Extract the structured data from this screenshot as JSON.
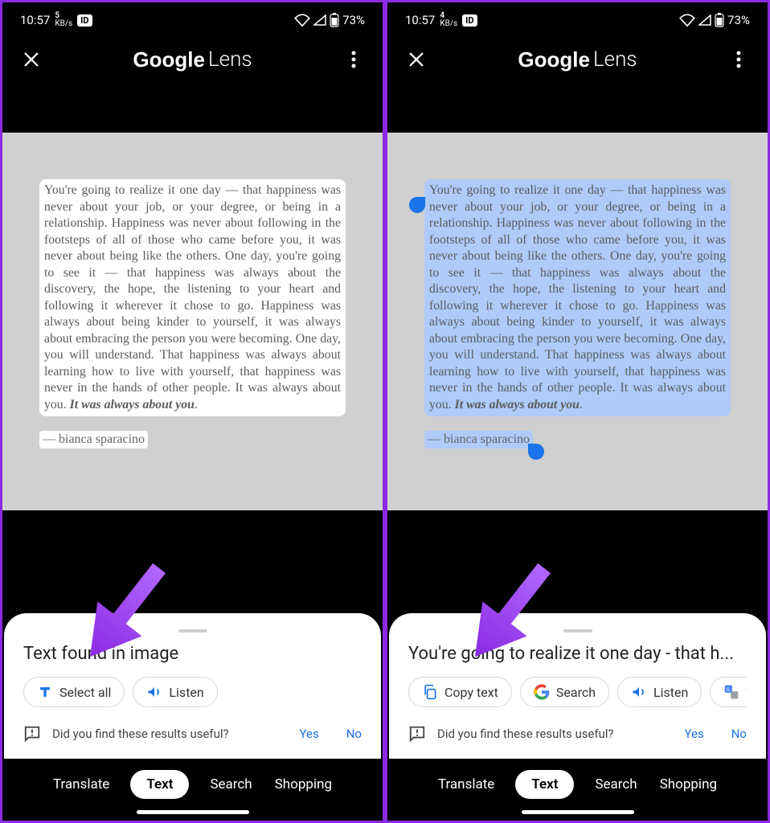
{
  "status": {
    "time": "10:57",
    "kbs1": "5",
    "kbs2": "4",
    "kbs_unit": "KB/s",
    "battery": "73%"
  },
  "app": {
    "title_google": "Google",
    "title_lens": "Lens"
  },
  "scanned_text": "You're going to realize it one day — that happiness was never about your job, or your degree, or being in a relationship. Happiness was never about following in the footsteps of all of those who came before you, it was never about being like the others. One day, you're going to see it — that happiness was always about the discovery, the hope, the listening to your heart and following it wherever it chose to go. Happiness was always about being kinder to yourself, it was always about embracing the person you were becoming. One day, you will understand. That happiness was always about learning how to live with yourself, that happiness was never in the hands of other people. It was always about you. ",
  "scanned_bold": "It was always about you",
  "author": "— bianca sparacino",
  "sheet1": {
    "title": "Text found in image",
    "chips": {
      "select_all": "Select all",
      "listen": "Listen"
    }
  },
  "sheet2": {
    "title": "You're going to realize it one day - that h...",
    "chips": {
      "copy": "Copy text",
      "search": "Search",
      "listen": "Listen",
      "translate": "Tr"
    }
  },
  "feedback": {
    "question": "Did you find these results useful?",
    "yes": "Yes",
    "no": "No"
  },
  "tabs": {
    "translate": "Translate",
    "text": "Text",
    "search": "Search",
    "shopping": "Shopping"
  }
}
